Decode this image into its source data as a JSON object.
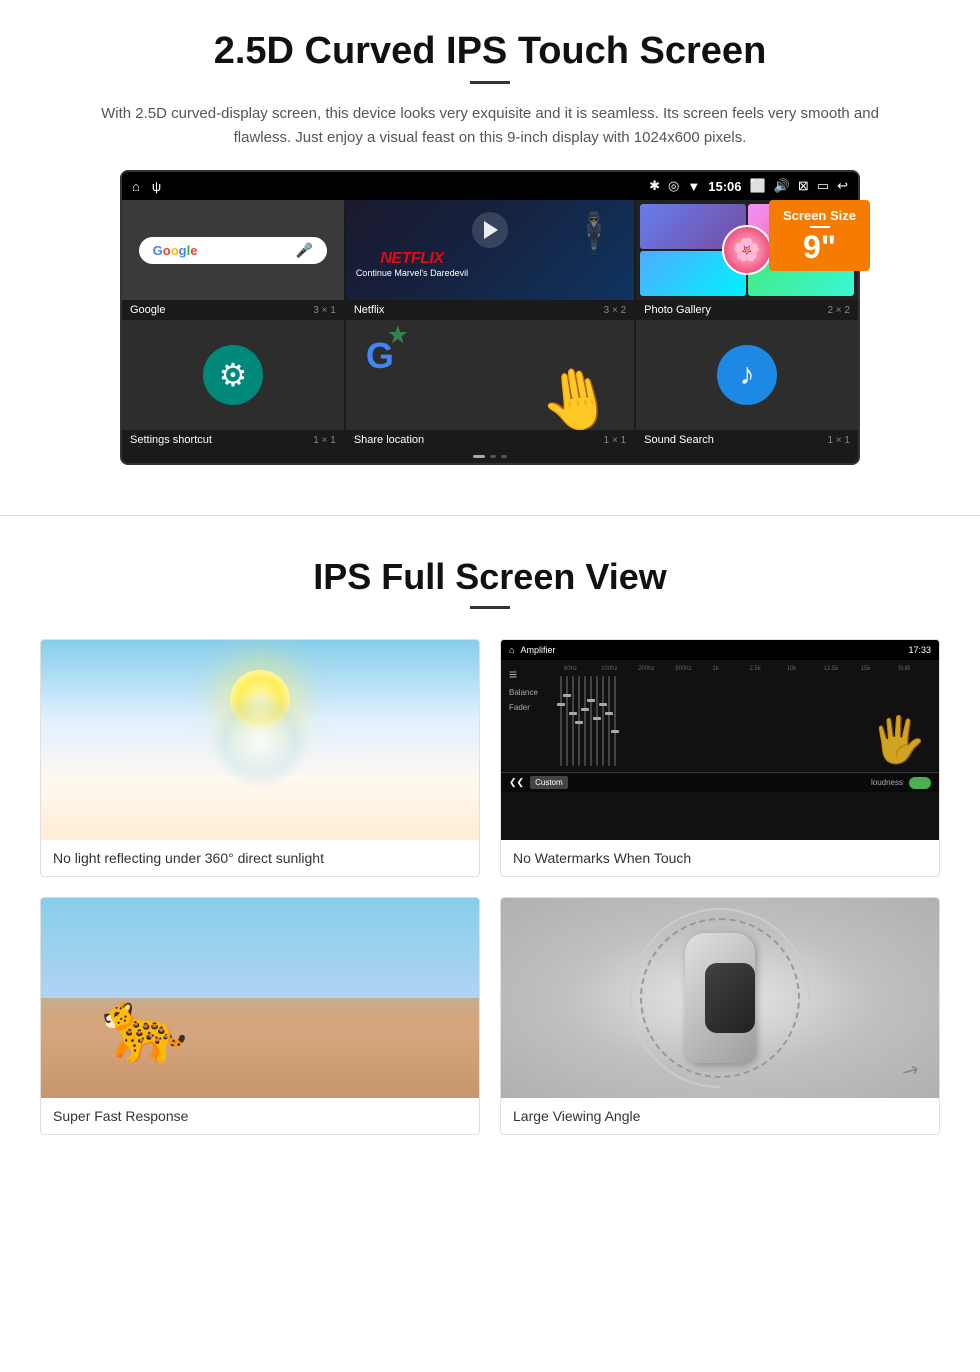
{
  "section1": {
    "title": "2.5D Curved IPS Touch Screen",
    "description": "With 2.5D curved-display screen, this device looks very exquisite and it is seamless. Its screen feels very smooth and flawless. Just enjoy a visual feast on this 9-inch display with 1024x600 pixels.",
    "badge": {
      "title": "Screen Size",
      "size": "9\""
    },
    "statusBar": {
      "time": "15:06"
    },
    "apps": [
      {
        "name": "Google",
        "size": "3 × 1"
      },
      {
        "name": "Netflix",
        "size": "3 × 2"
      },
      {
        "name": "Photo Gallery",
        "size": "2 × 2"
      },
      {
        "name": "Settings shortcut",
        "size": "1 × 1"
      },
      {
        "name": "Share location",
        "size": "1 × 1"
      },
      {
        "name": "Sound Search",
        "size": "1 × 1"
      }
    ],
    "netflix": {
      "logo": "NETFLIX",
      "subtitle": "Continue Marvel's Daredevil"
    }
  },
  "section2": {
    "title": "IPS Full Screen View",
    "features": [
      {
        "id": "no-light",
        "label": "No light reflecting under 360° direct sunlight"
      },
      {
        "id": "no-watermarks",
        "label": "No Watermarks When Touch"
      },
      {
        "id": "fast-response",
        "label": "Super Fast Response"
      },
      {
        "id": "viewing-angle",
        "label": "Large Viewing Angle"
      }
    ]
  }
}
